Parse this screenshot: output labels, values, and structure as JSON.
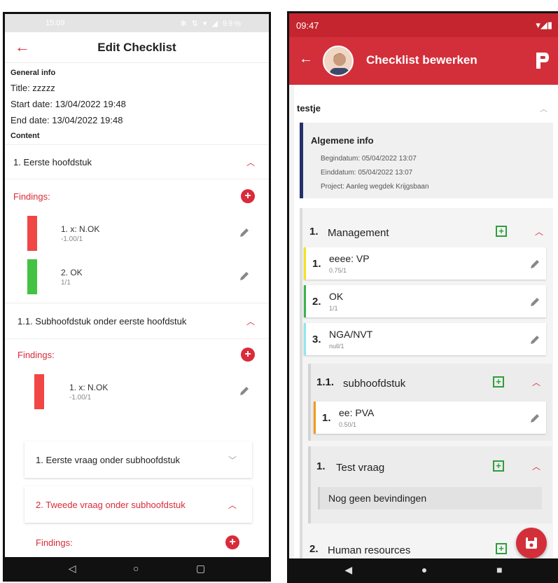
{
  "left": {
    "status_bar": {
      "time": "15:09",
      "icons": "✻ ⇅ ▾ ◢ 99%"
    },
    "app_bar": {
      "title": "Edit Checklist"
    },
    "general": {
      "heading": "General info",
      "title": "Title: zzzzz",
      "start": "Start date: 13/04/2022 19:48",
      "end": "End date: 13/04/2022 19:48"
    },
    "content_heading": "Content",
    "chapter1": {
      "label": "1. Eerste hoofdstuk"
    },
    "findings_label": "Findings:",
    "findings1": [
      {
        "title": "1. x: N.OK",
        "score": "-1.00/1",
        "color": "#f04646"
      },
      {
        "title": "2. OK",
        "score": "1/1",
        "color": "#44c244"
      }
    ],
    "sub1": {
      "label": "1.1. Subhoofdstuk onder eerste hoofdstuk"
    },
    "findings2": [
      {
        "title": "1. x: N.OK",
        "score": "-1.00/1",
        "color": "#f04646"
      }
    ],
    "q1": {
      "label": "1. Eerste vraag onder subhoofdstuk"
    },
    "q2": {
      "label": "2. Tweede vraag onder subhoofdstuk"
    },
    "colors": {
      "accent": "#d92b3a"
    }
  },
  "right": {
    "status_bar": {
      "time": "09:47"
    },
    "app_bar": {
      "title": "Checklist bewerken"
    },
    "checklist_name": "testje",
    "general": {
      "heading": "Algemene info",
      "begin": "Begindatum: 05/04/2022 13:07",
      "end": "Einddatum: 05/04/2022 13:07",
      "project": "Project: Aanleg wegdek Krijgsbaan"
    },
    "sections": {
      "management": {
        "num": "1.",
        "title": "Management"
      },
      "sub": {
        "num": "1.1.",
        "title": "subhoofdstuk"
      },
      "test": {
        "num": "1.",
        "title": "Test vraag"
      },
      "human": {
        "num": "2.",
        "title": "Human resources"
      }
    },
    "questions": [
      {
        "num": "1.",
        "title": "eeee: VP",
        "score": "0.75/1",
        "color": "#f5e21c"
      },
      {
        "num": "2.",
        "title": "OK",
        "score": "1/1",
        "color": "#3bb34a"
      },
      {
        "num": "3.",
        "title": "NGA/NVT",
        "score": "null/1",
        "color": "#8fe6ef"
      }
    ],
    "sub_question": {
      "num": "1.",
      "title": "ee: PVA",
      "score": "0.50/1",
      "color": "#f39a1c"
    },
    "no_findings": "Nog geen bevindingen",
    "colors": {
      "brand": "#d32f3a",
      "add": "#2e9e3c"
    }
  }
}
